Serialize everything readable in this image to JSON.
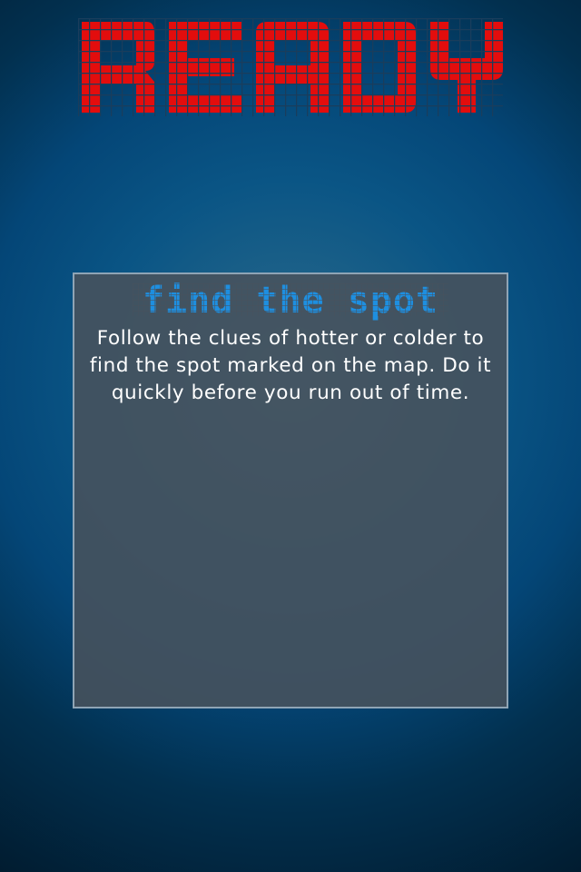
{
  "title": "READY",
  "title_color": "#e30d0d",
  "panel": {
    "heading": "find the spot",
    "heading_color": "#1e8fe0",
    "description": "Follow the clues of hotter or colder to find the spot marked on the map.  Do it quickly before you run out of time."
  }
}
